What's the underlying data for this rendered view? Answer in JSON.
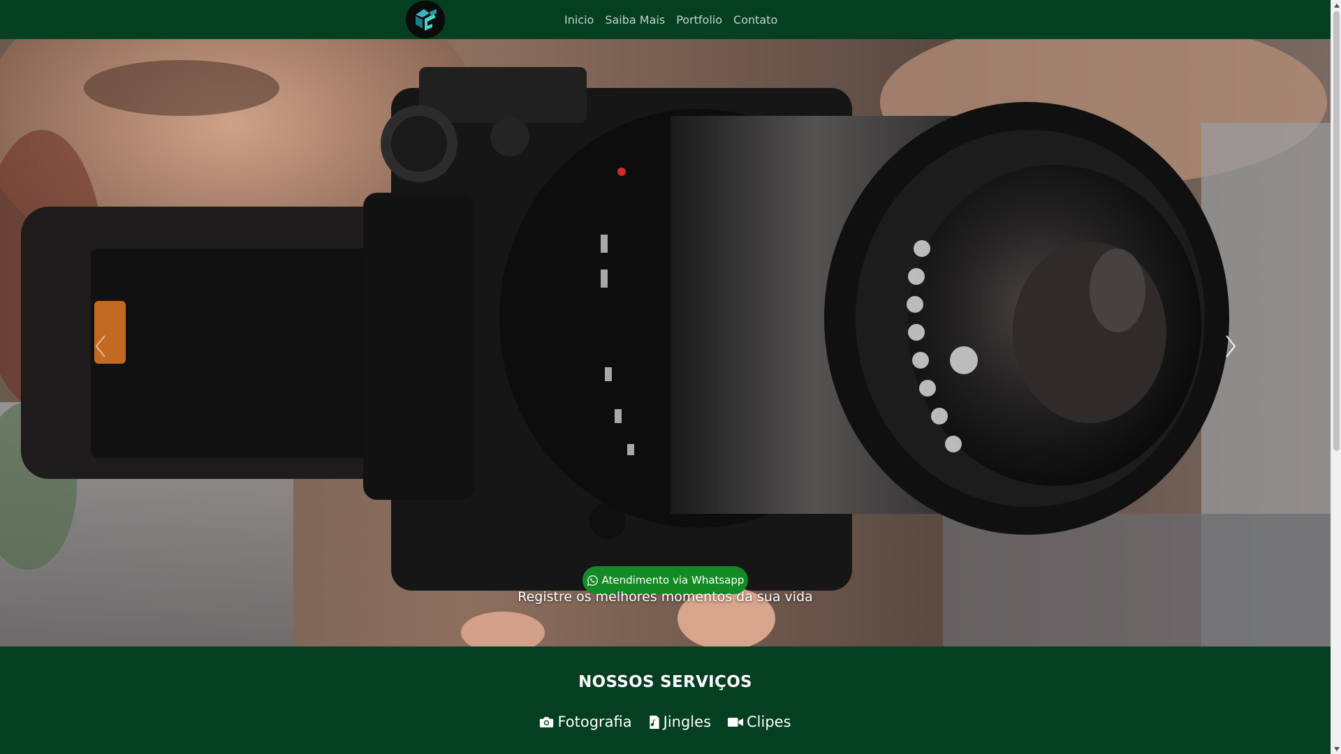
{
  "navbar": {
    "logo_icon": "cf-logo",
    "links": [
      "Inicio",
      "Saiba Mais",
      "Portfolio",
      "Contato"
    ]
  },
  "hero": {
    "whatsapp_icon": "whatsapp-icon",
    "whatsapp_label": "Atendimento via Whatsapp",
    "caption": "Registre os melhores momentos da sua vida",
    "prev_icon": "chevron-left-icon",
    "next_icon": "chevron-right-icon"
  },
  "services": {
    "title": "NOSSOS SERVIÇOS",
    "items": [
      {
        "label": "Fotografia",
        "icon": "camera-icon"
      },
      {
        "label": "Jingles",
        "icon": "music-file-icon"
      },
      {
        "label": "Clipes",
        "icon": "video-camera-icon"
      }
    ]
  },
  "colors": {
    "brand_green": "#043f21",
    "whatsapp_green": "#148a24",
    "nav_text": "#c7d3cc"
  }
}
